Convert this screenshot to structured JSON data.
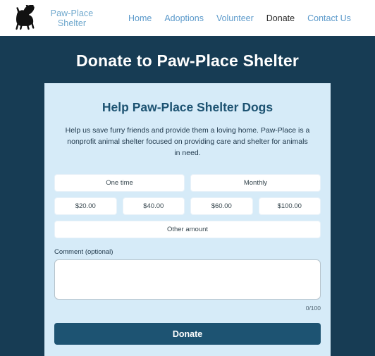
{
  "header": {
    "logo_icon": "cat-silhouette-icon",
    "brand_line1": "Paw-Place",
    "brand_line2": "Shelter",
    "nav": [
      {
        "label": "Home",
        "active": false
      },
      {
        "label": "Adoptions",
        "active": false
      },
      {
        "label": "Volunteer",
        "active": false
      },
      {
        "label": "Donate",
        "active": true
      },
      {
        "label": "Contact Us",
        "active": false
      }
    ]
  },
  "hero": {
    "title": "Donate to Paw-Place Shelter"
  },
  "card": {
    "title": "Help Paw-Place Shelter Dogs",
    "description": "Help us save furry friends and provide them a loving home. Paw-Place is a nonprofit animal shelter focused on providing care and shelter for animals in need.",
    "frequency_options": [
      {
        "label": "One time"
      },
      {
        "label": "Monthly"
      }
    ],
    "amount_options": [
      {
        "label": "$20.00"
      },
      {
        "label": "$40.00"
      },
      {
        "label": "$60.00"
      },
      {
        "label": "$100.00"
      }
    ],
    "other_amount_label": "Other amount",
    "comment_label": "Comment (optional)",
    "comment_value": "",
    "comment_placeholder": "",
    "char_counter": "0/100",
    "submit_label": "Donate"
  },
  "colors": {
    "dark_teal": "#173c54",
    "card_bg": "#d6ebf8",
    "accent_blue": "#1d5372",
    "nav_link": "#5c9acb",
    "brand_text": "#6fa8cd"
  }
}
